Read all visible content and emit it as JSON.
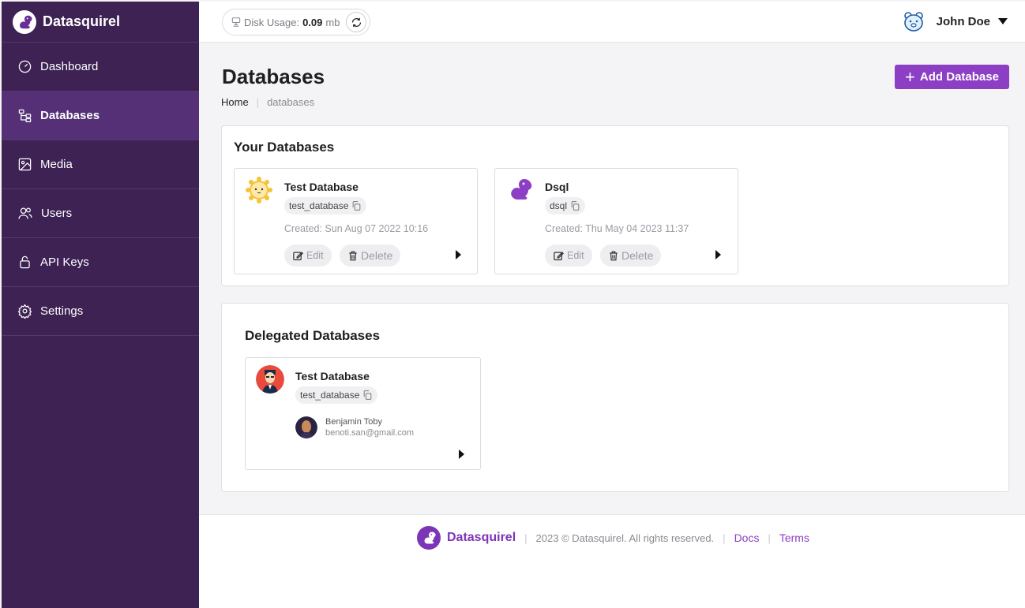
{
  "brand": {
    "name": "Datasquirel",
    "logo_icon": "squirrel-logo-icon",
    "accent": "#8c3fc4",
    "sidebar_bg": "#3d2253"
  },
  "sidebar": {
    "items": [
      {
        "label": "Dashboard",
        "icon": "gauge-icon",
        "active": false
      },
      {
        "label": "Databases",
        "icon": "database-tree-icon",
        "active": true
      },
      {
        "label": "Media",
        "icon": "image-icon",
        "active": false
      },
      {
        "label": "Users",
        "icon": "users-icon",
        "active": false
      },
      {
        "label": "API Keys",
        "icon": "lock-icon",
        "active": false
      },
      {
        "label": "Settings",
        "icon": "gear-icon",
        "active": false
      }
    ]
  },
  "topbar": {
    "disk_label": "Disk Usage:",
    "disk_value": "0.09",
    "disk_unit": "mb",
    "user_name": "John Doe"
  },
  "page": {
    "title": "Databases",
    "breadcrumb": {
      "home": "Home",
      "current": "databases"
    },
    "add_button": "Add Database"
  },
  "your_databases": {
    "title": "Your Databases",
    "cards": [
      {
        "name": "Test Database",
        "slug": "test_database",
        "created": "Created: Sun Aug 07 2022 10:16",
        "edit": "Edit",
        "delete": "Delete"
      },
      {
        "name": "Dsql",
        "slug": "dsql",
        "created": "Created: Thu May 04 2023 11:37",
        "edit": "Edit",
        "delete": "Delete"
      }
    ]
  },
  "delegated_databases": {
    "title": "Delegated Databases",
    "cards": [
      {
        "name": "Test Database",
        "slug": "test_database",
        "owner_name": "Benjamin Toby",
        "owner_email": "benoti.san@gmail.com"
      }
    ]
  },
  "footer": {
    "brand": "Datasquirel",
    "copyright": "2023 © Datasquirel. All rights reserved.",
    "docs": "Docs",
    "terms": "Terms"
  }
}
